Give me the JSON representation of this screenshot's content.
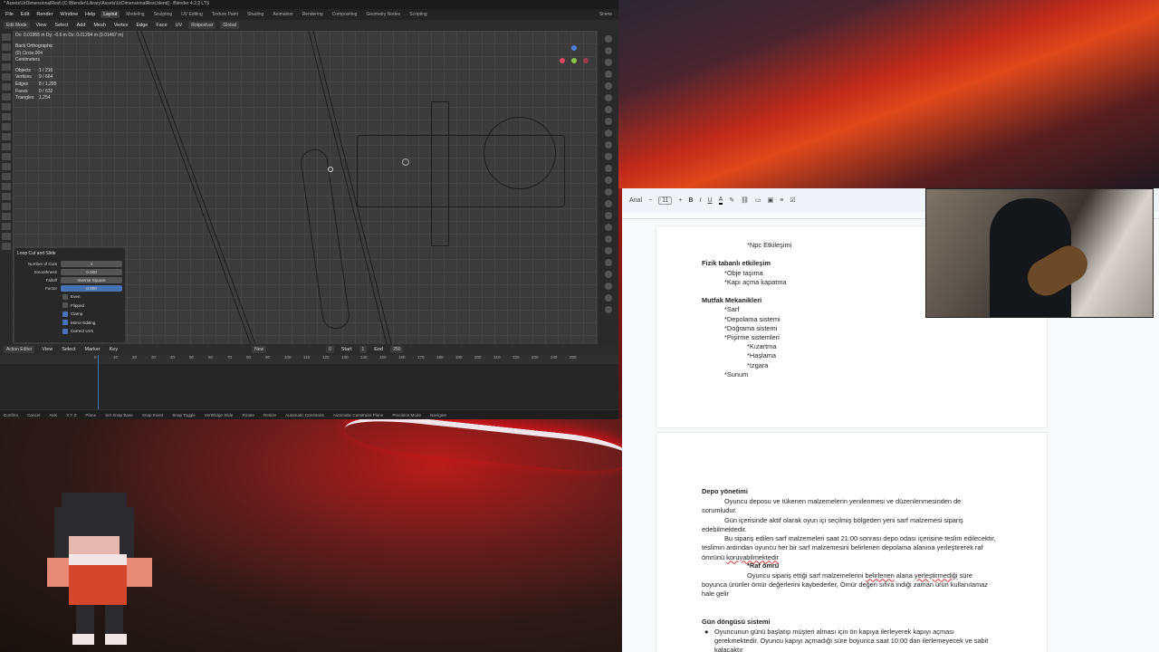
{
  "blender": {
    "title": "* Assets\\UrDimensionalRest\\ [C:\\Blender\\Library\\Assets\\UrDimensionalRest.blend] - Blender 4.2.2 LTS",
    "menus": [
      "File",
      "Edit",
      "Render",
      "Window",
      "Help"
    ],
    "workspaces": [
      "Layout",
      "Modeling",
      "Sculpting",
      "UV Editing",
      "Texture Paint",
      "Shading",
      "Animation",
      "Rendering",
      "Compositing",
      "Geometry Nodes",
      "Scripting"
    ],
    "active_workspace": "Layout",
    "scene_label": "Scene",
    "mode": "Edit Mode",
    "header_menus": [
      "View",
      "Select",
      "Add",
      "Mesh",
      "Vertex",
      "Edge",
      "Face",
      "UV"
    ],
    "transform_orientation": "Global",
    "snap_label": "Rotpostvar",
    "readout": "Dx: 0.01955 m   Dy: -0.6 m   Dz: 0.01294 m (0.01467 m)",
    "view_name": "Back Orthographic",
    "object_name": "(0) Circle.004",
    "units": "Centimeters",
    "stats": [
      {
        "k": "Objects",
        "v": "1 / 216"
      },
      {
        "k": "Vertices",
        "v": "9 / 664"
      },
      {
        "k": "Edges",
        "v": "8 / 1,295"
      },
      {
        "k": "Faces",
        "v": "0 / 632"
      },
      {
        "k": "Triangles",
        "v": "1,254"
      }
    ],
    "operator_panel": {
      "title": "Loop Cut and Slide",
      "fields": [
        {
          "label": "Number of Cuts",
          "value": "1"
        },
        {
          "label": "Smoothness",
          "value": "0.000"
        },
        {
          "label": "Falloff",
          "value": "Inverse Square"
        },
        {
          "label": "Factor",
          "value": "0.000"
        }
      ],
      "checks": [
        {
          "label": "Even",
          "on": false
        },
        {
          "label": "Flipped",
          "on": false
        },
        {
          "label": "Clamp",
          "on": true
        },
        {
          "label": "Mirror Editing",
          "on": true
        },
        {
          "label": "Correct UVs",
          "on": true
        }
      ]
    },
    "timeline": {
      "editor": "Action Editor",
      "menus": [
        "View",
        "Select",
        "Marker",
        "Key"
      ],
      "new_label": "New",
      "start_label": "Start",
      "start": "1",
      "end_label": "End",
      "end": "250",
      "current": "0",
      "frames": [
        "0",
        "10",
        "20",
        "30",
        "40",
        "50",
        "60",
        "70",
        "80",
        "90",
        "100",
        "110",
        "120",
        "130",
        "140",
        "150",
        "160",
        "170",
        "180",
        "190",
        "200",
        "210",
        "220",
        "230",
        "240",
        "250"
      ]
    },
    "status_items": [
      "Confirm",
      "Cancel",
      "Axis",
      "X Y Z",
      "Plane",
      "Set Snap Base",
      "Snap Invert",
      "Snap Toggle",
      "Vert/Edge Slide",
      "Rotate",
      "Resize",
      "Automatic Constraint",
      "Automatic Constraint Plane",
      "Precision Mode",
      "Navigate"
    ]
  },
  "docs": {
    "font": "Arial",
    "font_size": "11",
    "page1": [
      {
        "text": "*Npc Etkileşimi",
        "indent": 2,
        "bold": false
      },
      {
        "text": "",
        "indent": 0,
        "bold": false
      },
      {
        "text": "Fizik tabanlı etkileşim",
        "indent": 0,
        "bold": true
      },
      {
        "text": "*Obje taşıma",
        "indent": 1,
        "bold": false
      },
      {
        "text": "*Kapı açma kapatma",
        "indent": 1,
        "bold": false
      },
      {
        "text": "",
        "indent": 0,
        "bold": false
      },
      {
        "text": "Mutfak Mekanikleri",
        "indent": 0,
        "bold": true
      },
      {
        "text": "*Sarf",
        "indent": 1,
        "bold": false
      },
      {
        "text": "*Depolama sistemi",
        "indent": 1,
        "bold": false
      },
      {
        "text": "*Doğrama sistemi",
        "indent": 1,
        "bold": false
      },
      {
        "text": "*Pişirme sistemleri",
        "indent": 1,
        "bold": false
      },
      {
        "text": "*Kızartma",
        "indent": 2,
        "bold": false
      },
      {
        "text": "*Haşlama",
        "indent": 2,
        "bold": false
      },
      {
        "text": "*Izgara",
        "indent": 2,
        "bold": false
      },
      {
        "text": "*Sunum",
        "indent": 1,
        "bold": false
      }
    ],
    "page2": {
      "heading1": "Depo yönetimi",
      "para1": "Oyuncu deposu ve tükenen malzemelerin yenilenmesi ve düzenlenmesinden de sorumludur.",
      "para2": "Gün içerisinde aktif olarak oyun içi seçilmiş bölgeden yeni sarf malzemesi sipariş edebilmektedir.",
      "para3a": "Bu sipariş edilen sarf malzemeleri saat 21:00 sonrası depo odası içerisine teslim edilecektir, teslimin ardından oyuncu her bir sarf malzemesini belirlenen depolama alanına yerleştirerek raf ömrünü ",
      "para3b": "koruyabilmektedir",
      "heading2": "*Raf ömrü",
      "para4a": "Oyuncu sipariş ettiği sarf malzemelerini ",
      "para4b": "belirlenen",
      "para4c": " alana ",
      "para4d": "yerleştirmediği",
      "para4e": " süre boyunca ürünler ömür değerlerini kaybederler, Ömür değeri sıfıra indiği zaman ürün kullanılamaz hale gelir",
      "heading3": "Gün döngüsü sistemi",
      "bullet1": "Oyuncunun günü başlatıp müşteri alması için ön kapıya ilerleyerek kapıyı açması gerekmektedir. Oyuncu kapıyı açmadığı süre boyunca saat 10:00 dan ilerlemeyecek ve sabit kalacaktır"
    }
  },
  "colors": {
    "blender_bg": "#303030",
    "accent_blue": "#4772b3",
    "docs_bg": "#f8f9fa"
  }
}
